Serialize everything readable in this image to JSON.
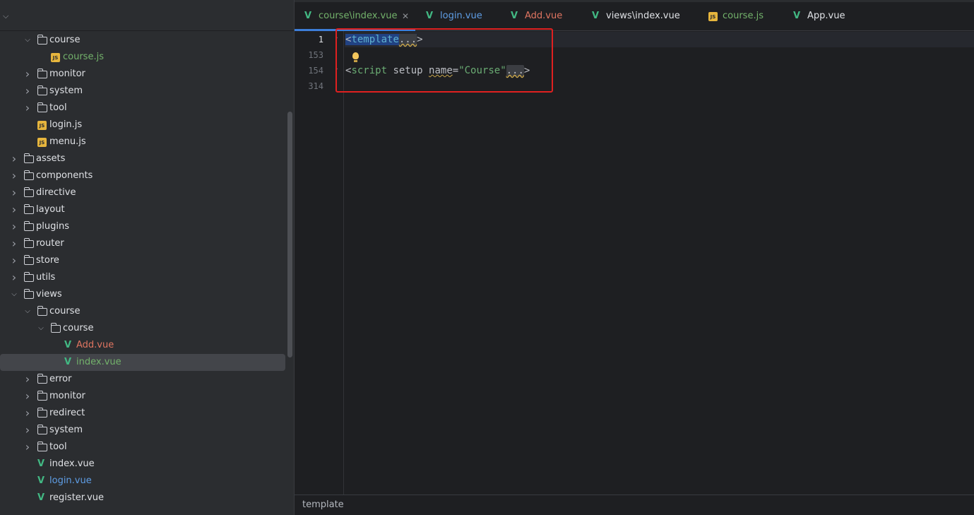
{
  "sidebar": {
    "tree": [
      {
        "label": "course",
        "type": "folder",
        "expanded": true,
        "depth": 2,
        "color": "default"
      },
      {
        "label": "course.js",
        "type": "js",
        "depth": 3,
        "color": "green"
      },
      {
        "label": "monitor",
        "type": "folder",
        "expanded": false,
        "depth": 2,
        "color": "default"
      },
      {
        "label": "system",
        "type": "folder",
        "expanded": false,
        "depth": 2,
        "color": "default"
      },
      {
        "label": "tool",
        "type": "folder",
        "expanded": false,
        "depth": 2,
        "color": "default"
      },
      {
        "label": "login.js",
        "type": "js",
        "depth": 2,
        "color": "default"
      },
      {
        "label": "menu.js",
        "type": "js",
        "depth": 2,
        "color": "default"
      },
      {
        "label": "assets",
        "type": "folder",
        "expanded": false,
        "depth": 1,
        "color": "default"
      },
      {
        "label": "components",
        "type": "folder",
        "expanded": false,
        "depth": 1,
        "color": "default"
      },
      {
        "label": "directive",
        "type": "folder",
        "expanded": false,
        "depth": 1,
        "color": "default"
      },
      {
        "label": "layout",
        "type": "folder",
        "expanded": false,
        "depth": 1,
        "color": "default"
      },
      {
        "label": "plugins",
        "type": "folder",
        "expanded": false,
        "depth": 1,
        "color": "default"
      },
      {
        "label": "router",
        "type": "folder",
        "expanded": false,
        "depth": 1,
        "color": "default"
      },
      {
        "label": "store",
        "type": "folder",
        "expanded": false,
        "depth": 1,
        "color": "default"
      },
      {
        "label": "utils",
        "type": "folder",
        "expanded": false,
        "depth": 1,
        "color": "default"
      },
      {
        "label": "views",
        "type": "folder",
        "expanded": true,
        "depth": 1,
        "color": "default"
      },
      {
        "label": "course",
        "type": "folder",
        "expanded": true,
        "depth": 2,
        "color": "default"
      },
      {
        "label": "course",
        "type": "folder",
        "expanded": true,
        "depth": 3,
        "color": "default"
      },
      {
        "label": "Add.vue",
        "type": "vue",
        "depth": 4,
        "color": "red"
      },
      {
        "label": "index.vue",
        "type": "vue",
        "depth": 4,
        "color": "green",
        "selected": true
      },
      {
        "label": "error",
        "type": "folder",
        "expanded": false,
        "depth": 2,
        "color": "default"
      },
      {
        "label": "monitor",
        "type": "folder",
        "expanded": false,
        "depth": 2,
        "color": "default"
      },
      {
        "label": "redirect",
        "type": "folder",
        "expanded": false,
        "depth": 2,
        "color": "default"
      },
      {
        "label": "system",
        "type": "folder",
        "expanded": false,
        "depth": 2,
        "color": "default"
      },
      {
        "label": "tool",
        "type": "folder",
        "expanded": false,
        "depth": 2,
        "color": "default"
      },
      {
        "label": "index.vue",
        "type": "vue",
        "depth": 2,
        "color": "default"
      },
      {
        "label": "login.vue",
        "type": "vue",
        "depth": 2,
        "color": "blue"
      },
      {
        "label": "register.vue",
        "type": "vue",
        "depth": 2,
        "color": "default"
      }
    ]
  },
  "tabs": [
    {
      "label": "course\\index.vue",
      "type": "vue",
      "color": "green",
      "active": true
    },
    {
      "label": "login.vue",
      "type": "vue",
      "color": "blue"
    },
    {
      "label": "Add.vue",
      "type": "vue",
      "color": "red"
    },
    {
      "label": "views\\index.vue",
      "type": "vue",
      "color": "default"
    },
    {
      "label": "course.js",
      "type": "js",
      "color": "green"
    },
    {
      "label": "App.vue",
      "type": "vue",
      "color": "default"
    }
  ],
  "editor": {
    "line_numbers": [
      "1",
      "153",
      "154",
      "314"
    ],
    "line1": {
      "open": "<",
      "tag": "template",
      "fold": "...",
      "close": ">"
    },
    "line3": {
      "open": "<",
      "tag": "script",
      "space1": " setup ",
      "attr": "name",
      "eq": "=",
      "value": "\"Course\"",
      "fold": "...",
      "close": ">"
    }
  },
  "status": {
    "breadcrumb": "template"
  },
  "colors": {
    "accent": "#3d7ed9",
    "highlight_box": "#e02020",
    "vue_green": "#42b883"
  }
}
